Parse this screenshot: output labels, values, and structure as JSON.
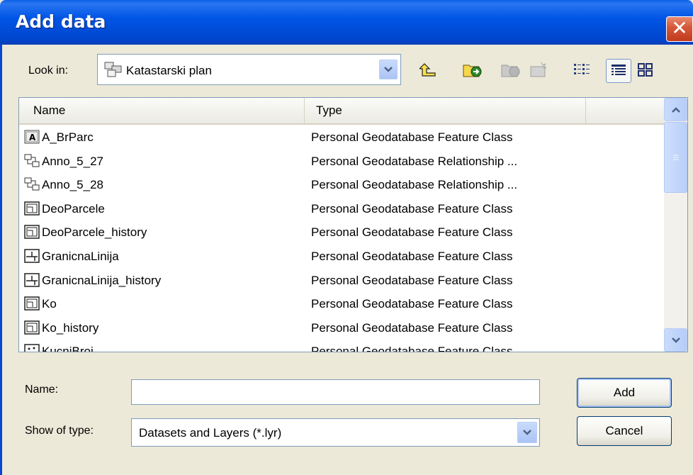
{
  "window": {
    "title": "Add data",
    "close_symbol": "✕"
  },
  "look_in": {
    "label": "Look in:",
    "value": "Katastarski plan",
    "icon": "geodatabase-icon"
  },
  "toolbar": {
    "buttons": [
      "up-one-level-icon",
      "connect-to-folder-icon",
      "disconnect-folder-icon",
      "new-item-icon",
      "list-view-icon",
      "details-view-icon",
      "thumbnails-view-icon"
    ]
  },
  "list": {
    "columns": [
      "Name",
      "Type"
    ],
    "rows": [
      {
        "name": "A_BrParc",
        "type": "Personal Geodatabase Feature Class",
        "icon": "annotation-class-icon"
      },
      {
        "name": "Anno_5_27",
        "type": "Personal Geodatabase Relationship ...",
        "icon": "relationship-class-icon"
      },
      {
        "name": "Anno_5_28",
        "type": "Personal Geodatabase Relationship ...",
        "icon": "relationship-class-icon"
      },
      {
        "name": "DeoParcele",
        "type": "Personal Geodatabase Feature Class",
        "icon": "polygon-class-icon"
      },
      {
        "name": "DeoParcele_history",
        "type": "Personal Geodatabase Feature Class",
        "icon": "polygon-class-icon"
      },
      {
        "name": "GranicnaLinija",
        "type": "Personal Geodatabase Feature Class",
        "icon": "line-class-icon"
      },
      {
        "name": "GranicnaLinija_history",
        "type": "Personal Geodatabase Feature Class",
        "icon": "line-class-icon"
      },
      {
        "name": "Ko",
        "type": "Personal Geodatabase Feature Class",
        "icon": "polygon-class-icon"
      },
      {
        "name": "Ko_history",
        "type": "Personal Geodatabase Feature Class",
        "icon": "polygon-class-icon"
      },
      {
        "name": "KucniBroj",
        "type": "Personal Geodatabase Feature Class",
        "icon": "point-class-icon"
      }
    ]
  },
  "form": {
    "name_label": "Name:",
    "name_value": "",
    "type_label": "Show of type:",
    "type_value": "Datasets and Layers (*.lyr)",
    "add_label": "Add",
    "cancel_label": "Cancel"
  },
  "colors": {
    "titlebar": "#0055e5",
    "dialog_bg": "#ece9d8",
    "close_button": "#d65a3b"
  }
}
